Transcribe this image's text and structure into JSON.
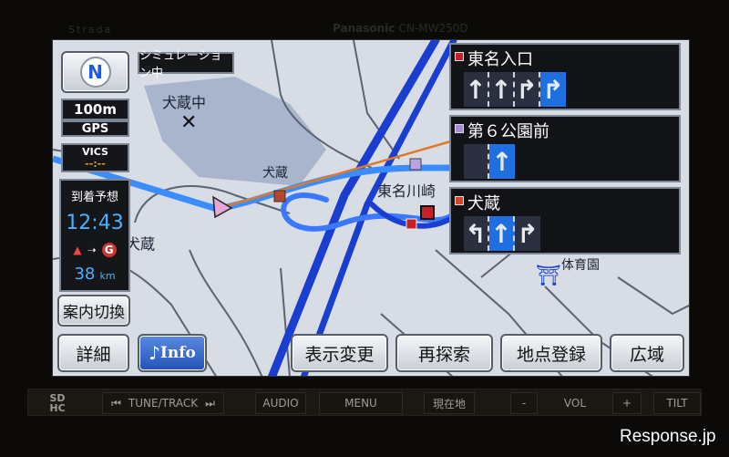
{
  "device": {
    "brand_left": "Strada",
    "brand_center": "Panasonic",
    "model": "CN-MW250D",
    "watermark": "Response.jp"
  },
  "status": {
    "simulation": "シミュレーション中",
    "scale": "100m",
    "gps": "GPS",
    "vics": "VICS",
    "vics_value": "--:--"
  },
  "eta": {
    "label": "到着予想",
    "time": "12:43",
    "distance_value": "38",
    "distance_unit": "km",
    "goal_icon": "G"
  },
  "buttons": {
    "guide_switch": "案内切換",
    "detail": "詳細",
    "info": "Info",
    "display_change": "表示変更",
    "reroute": "再探索",
    "register_point": "地点登録",
    "wide_area": "広域"
  },
  "lane_guides": [
    {
      "name": "東名入口",
      "pin_color": "#c8202a",
      "lanes": [
        {
          "arrow": "straight",
          "active": false
        },
        {
          "arrow": "straight",
          "active": false
        },
        {
          "arrow": "right",
          "active": false
        },
        {
          "arrow": "right",
          "active": true
        }
      ]
    },
    {
      "name": "第６公園前",
      "pin_color": "#a78bd8",
      "lanes": [
        {
          "arrow": "none",
          "active": false
        },
        {
          "arrow": "straight",
          "active": true
        }
      ]
    },
    {
      "name": "犬蔵",
      "pin_color": "#d4442a",
      "lanes": [
        {
          "arrow": "left-straight",
          "active": false
        },
        {
          "arrow": "straight",
          "active": true
        },
        {
          "arrow": "right",
          "active": false
        }
      ]
    }
  ],
  "map_labels": {
    "school": "犬蔵中",
    "area": "犬蔵",
    "interchange": "東名川崎",
    "intersection": "犬蔵",
    "park": "体育園"
  },
  "hardware": {
    "tune_track": "TUNE/TRACK",
    "audio": "AUDIO",
    "menu": "MENU",
    "current_location": "現在地",
    "vol": "VOL",
    "vol_minus": "-",
    "vol_plus": "+",
    "tilt": "TILT",
    "sd": "SD",
    "hc": "HC"
  },
  "colors": {
    "route": "#1f6fe0",
    "highway": "#1a3fd0",
    "active_lane": "#1f6fe0",
    "orange_line": "#e07a2a"
  }
}
